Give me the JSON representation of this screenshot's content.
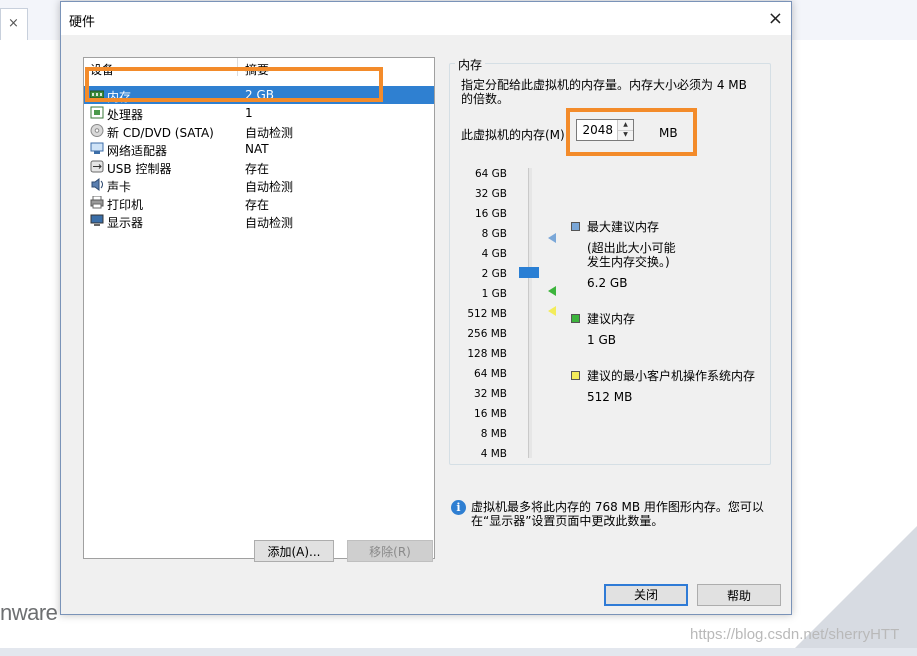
{
  "background": {
    "tab_close": "×",
    "logo": "nware",
    "watermark": "https://blog.csdn.net/sherryHTT"
  },
  "dialog": {
    "title": "硬件",
    "close_icon": "×"
  },
  "device_list": {
    "col_device": "设备",
    "col_summary": "摘要",
    "selected_index": 0,
    "rows": [
      {
        "icon": "memory-icon",
        "name": "内存",
        "summary": "2 GB"
      },
      {
        "icon": "processor-icon",
        "name": "处理器",
        "summary": "1"
      },
      {
        "icon": "cd-dvd-icon",
        "name": "新 CD/DVD (SATA)",
        "summary": "自动检测"
      },
      {
        "icon": "network-adapter-icon",
        "name": "网络适配器",
        "summary": "NAT"
      },
      {
        "icon": "usb-icon",
        "name": "USB 控制器",
        "summary": "存在"
      },
      {
        "icon": "sound-icon",
        "name": "声卡",
        "summary": "自动检测"
      },
      {
        "icon": "printer-icon",
        "name": "打印机",
        "summary": "存在"
      },
      {
        "icon": "display-icon",
        "name": "显示器",
        "summary": "自动检测"
      }
    ]
  },
  "buttons": {
    "add": "添加(A)...",
    "remove": "移除(R)",
    "close": "关闭",
    "help": "帮助"
  },
  "memory": {
    "group_title": "内存",
    "description": "指定分配给此虚拟机的内存量。内存大小必须为 4 MB 的倍数。",
    "field_label": "此虚拟机的内存(M)",
    "value": "2048",
    "unit": "MB",
    "scale": [
      "64 GB",
      "32 GB",
      "16 GB",
      "8 GB",
      "4 GB",
      "2 GB",
      "1 GB",
      "512 MB",
      "256 MB",
      "128 MB",
      "64 MB",
      "32 MB",
      "16 MB",
      "8 MB",
      "4 MB"
    ],
    "legend": {
      "max_title": "最大建议内存",
      "max_note_1": "(超出此大小可能",
      "max_note_2": "发生内存交换。)",
      "max_value": "6.2 GB",
      "rec_title": "建议内存",
      "rec_value": "1 GB",
      "min_title": "建议的最小客户机操作系统内存",
      "min_value": "512 MB"
    },
    "colors": {
      "max": "#7aa7d8",
      "recommended": "#3cb43c",
      "minimum": "#f3ec5a",
      "highlight": "#f38b2a",
      "selection": "#2f80d1"
    }
  },
  "info": {
    "icon": "info-icon",
    "text": "虚拟机最多将此内存的 768 MB 用作图形内存。您可以在“显示器”设置页面中更改此数量。"
  }
}
